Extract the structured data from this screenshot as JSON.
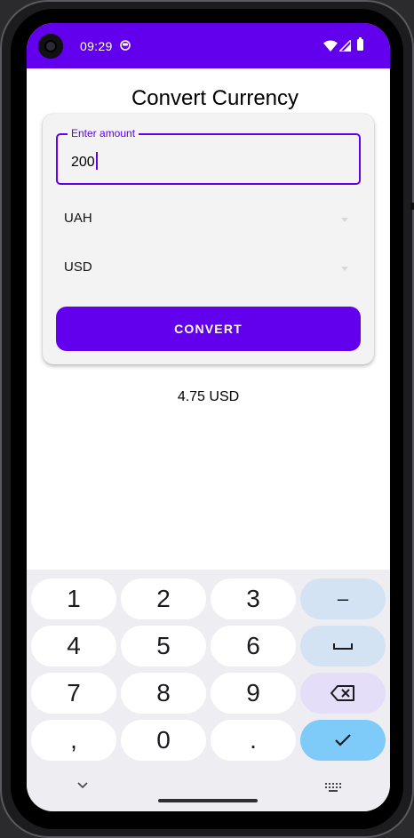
{
  "status_bar": {
    "time": "09:29",
    "color": "#6200ee",
    "icons": [
      "camera-icon",
      "app-notification-icon",
      "wifi-icon",
      "signal-icon",
      "battery-icon"
    ]
  },
  "app": {
    "title": "Convert Currency",
    "accent_color": "#6200ee",
    "amount_field": {
      "label": "Enter amount",
      "value": "200"
    },
    "from_currency": "UAH",
    "to_currency": "USD",
    "convert_button": "CONVERT",
    "result": "4.75 USD"
  },
  "keyboard": {
    "rows": [
      [
        {
          "label": "1",
          "type": "digit"
        },
        {
          "label": "2",
          "type": "digit"
        },
        {
          "label": "3",
          "type": "digit"
        },
        {
          "label": "–",
          "type": "minus"
        }
      ],
      [
        {
          "label": "4",
          "type": "digit"
        },
        {
          "label": "5",
          "type": "digit"
        },
        {
          "label": "6",
          "type": "digit"
        },
        {
          "label": "␣",
          "type": "space"
        }
      ],
      [
        {
          "label": "7",
          "type": "digit"
        },
        {
          "label": "8",
          "type": "digit"
        },
        {
          "label": "9",
          "type": "digit"
        },
        {
          "label": "⌫",
          "type": "backspace"
        }
      ],
      [
        {
          "label": ",",
          "type": "comma"
        },
        {
          "label": "0",
          "type": "digit"
        },
        {
          "label": ".",
          "type": "period"
        },
        {
          "label": "✓",
          "type": "done"
        }
      ]
    ],
    "bottom_icons": [
      "chevron-down-icon",
      "keyboard-switch-icon"
    ]
  }
}
